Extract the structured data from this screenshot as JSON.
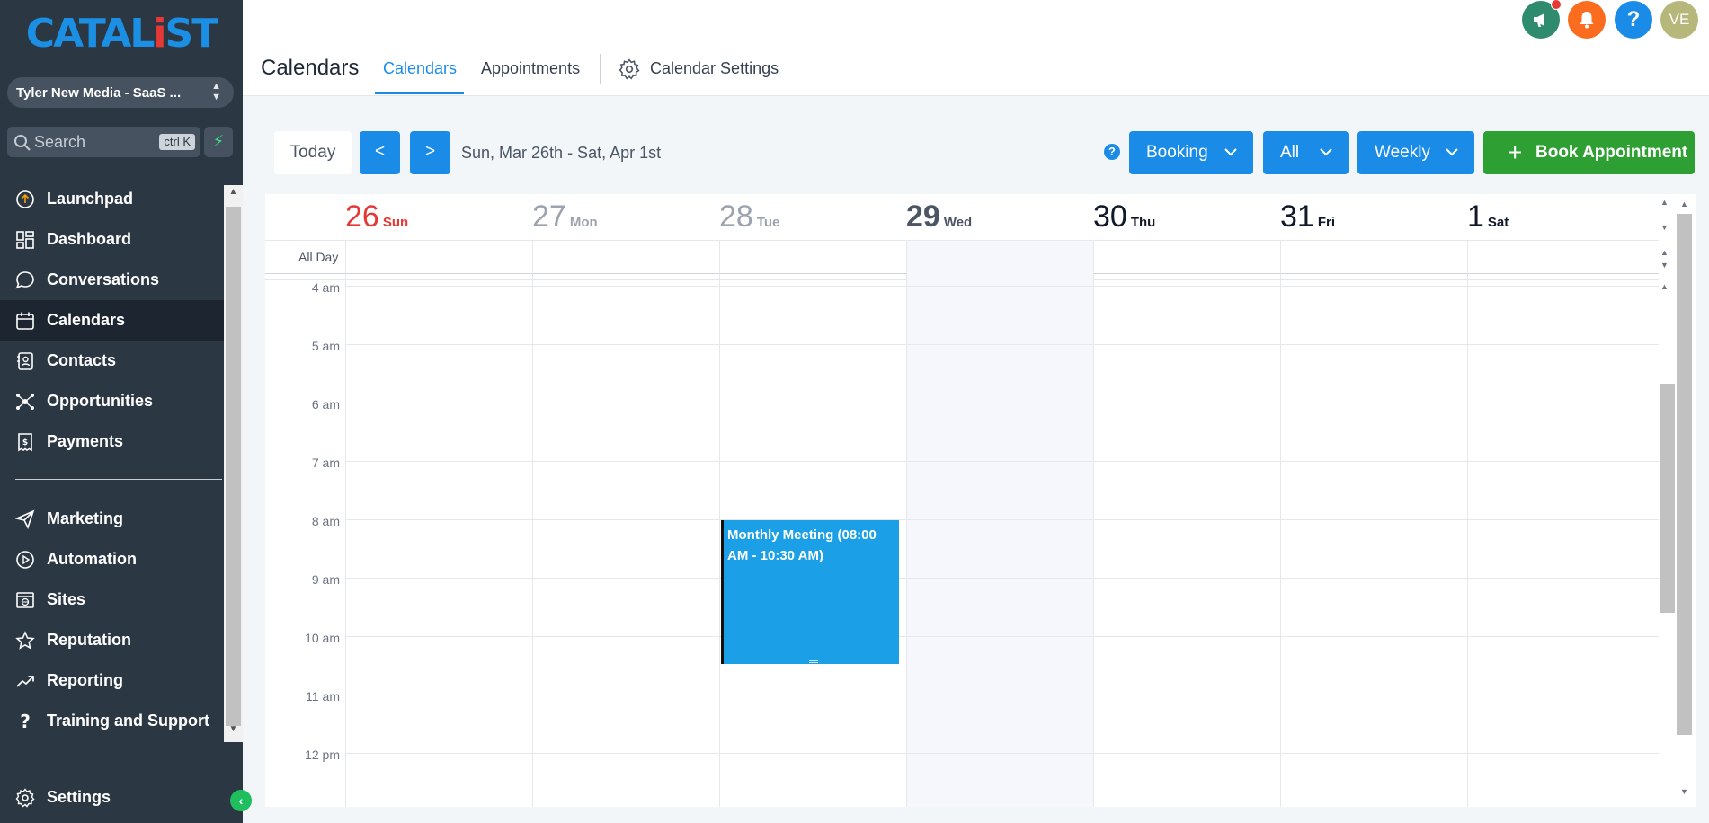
{
  "sidebar": {
    "logo": {
      "main": "CATAL",
      "dot": "i",
      "tail": "ST"
    },
    "account": "Tyler New Media - SaaS ...",
    "search": {
      "placeholder": "Search",
      "shortcut": "ctrl K"
    },
    "items": [
      {
        "label": "Launchpad",
        "icon": "launchpad-icon"
      },
      {
        "label": "Dashboard",
        "icon": "dashboard-icon"
      },
      {
        "label": "Conversations",
        "icon": "chat-icon"
      },
      {
        "label": "Calendars",
        "icon": "calendar-icon",
        "active": true
      },
      {
        "label": "Contacts",
        "icon": "contacts-icon"
      },
      {
        "label": "Opportunities",
        "icon": "opportunities-icon"
      },
      {
        "label": "Payments",
        "icon": "payments-icon"
      }
    ],
    "items2": [
      {
        "label": "Marketing",
        "icon": "send-icon"
      },
      {
        "label": "Automation",
        "icon": "automation-icon"
      },
      {
        "label": "Sites",
        "icon": "sites-icon"
      },
      {
        "label": "Reputation",
        "icon": "star-icon"
      },
      {
        "label": "Reporting",
        "icon": "trend-icon"
      },
      {
        "label": "Training and Support",
        "icon": "question-icon"
      }
    ],
    "settings": "Settings"
  },
  "header": {
    "title": "Calendars",
    "tabs": {
      "calendars": "Calendars",
      "appointments": "Appointments",
      "settings": "Calendar Settings"
    },
    "user_initials": "VE"
  },
  "toolbar": {
    "today": "Today",
    "prev": "<",
    "next": ">",
    "date_range": "Sun, Mar 26th - Sat, Apr 1st",
    "help": "?",
    "booking": "Booking",
    "filter": "All",
    "view": "Weekly",
    "book": "Book Appointment"
  },
  "calendar": {
    "days": [
      {
        "num": "26",
        "name": "Sun"
      },
      {
        "num": "27",
        "name": "Mon"
      },
      {
        "num": "28",
        "name": "Tue"
      },
      {
        "num": "29",
        "name": "Wed"
      },
      {
        "num": "30",
        "name": "Thu"
      },
      {
        "num": "31",
        "name": "Fri"
      },
      {
        "num": "1",
        "name": "Sat"
      }
    ],
    "all_day": "All Day",
    "hours": [
      "4 am",
      "5 am",
      "6 am",
      "7 am",
      "8 am",
      "9 am",
      "10 am",
      "11 am",
      "12 pm"
    ],
    "event": {
      "title": "Monthly Meeting (08:00 AM - 10:30 AM)"
    }
  },
  "colors": {
    "sidebar_bg": "#2c3744",
    "accent": "#1a8ce8",
    "book_green": "#2e9f33",
    "event_blue": "#1ba0e8",
    "sunday_red": "#e53935"
  }
}
